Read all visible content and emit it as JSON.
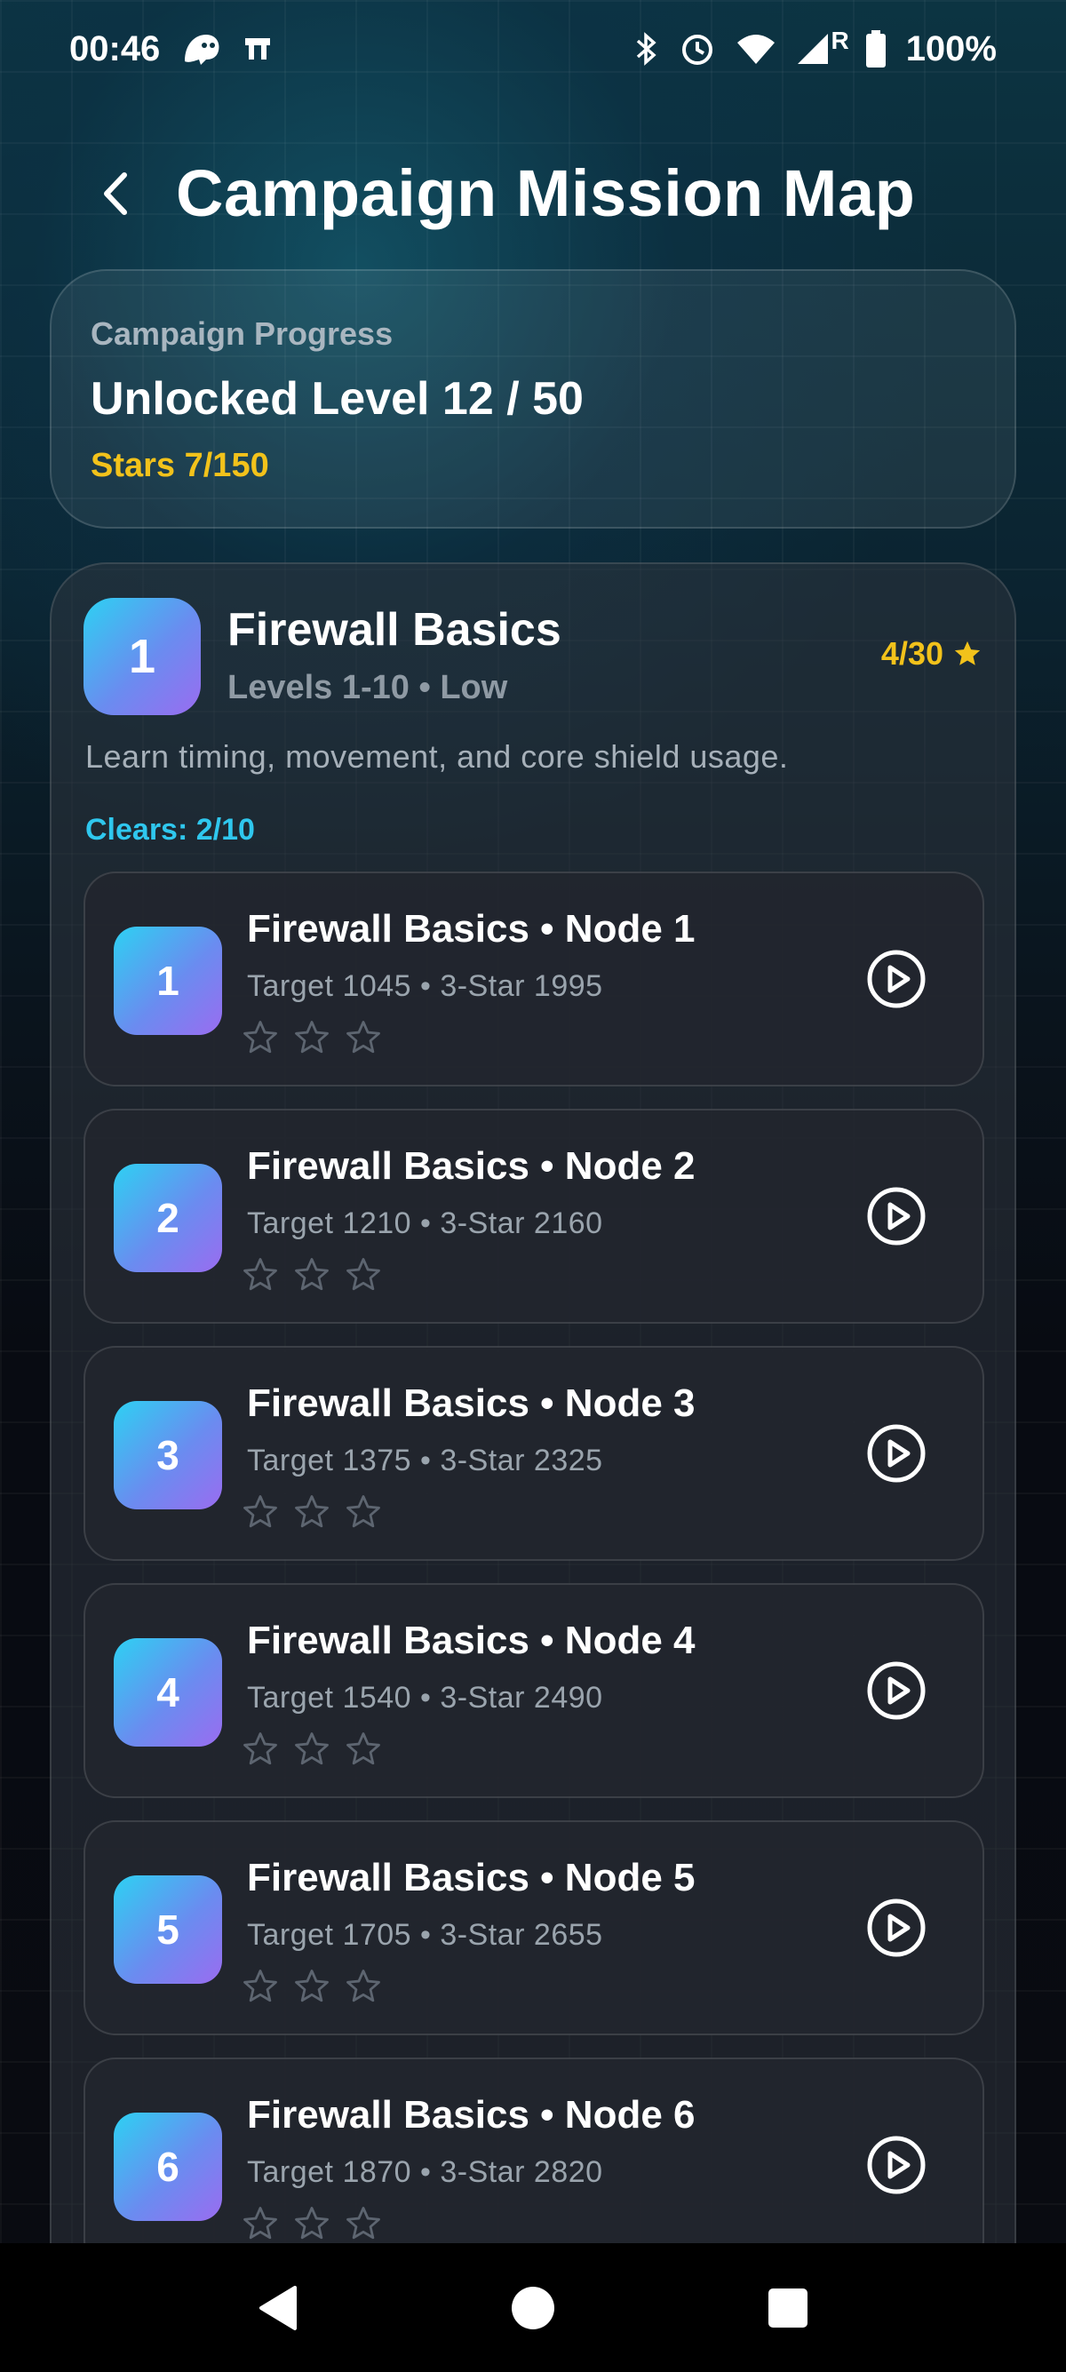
{
  "status_bar": {
    "time": "00:46",
    "battery": "100%",
    "icons": [
      "ghost-icon",
      "notification-icon",
      "bluetooth-icon",
      "alarm-icon",
      "wifi-icon",
      "signal-icon",
      "battery-icon"
    ],
    "roaming": "R"
  },
  "header": {
    "title": "Campaign Mission Map",
    "back_icon": "chevron-left-icon"
  },
  "progress": {
    "label": "Campaign Progress",
    "title": "Unlocked Level 12 / 50",
    "stars": "Stars 7/150"
  },
  "chapter": {
    "number": "1",
    "title": "Firewall Basics",
    "subtitle": "Levels 1-10 • Low",
    "stars": "4/30",
    "description": "Learn timing, movement, and core shield usage.",
    "clears": "Clears: 2/10"
  },
  "nodes": [
    {
      "number": "1",
      "title": "Firewall Basics • Node 1",
      "meta": "Target 1045 • 3-Star 1995",
      "stars_earned": 0
    },
    {
      "number": "2",
      "title": "Firewall Basics • Node 2",
      "meta": "Target 1210 • 3-Star 2160",
      "stars_earned": 0
    },
    {
      "number": "3",
      "title": "Firewall Basics • Node 3",
      "meta": "Target 1375 • 3-Star 2325",
      "stars_earned": 0
    },
    {
      "number": "4",
      "title": "Firewall Basics • Node 4",
      "meta": "Target 1540 • 3-Star 2490",
      "stars_earned": 0
    },
    {
      "number": "5",
      "title": "Firewall Basics • Node 5",
      "meta": "Target 1705 • 3-Star 2655",
      "stars_earned": 0
    },
    {
      "number": "6",
      "title": "Firewall Basics • Node 6",
      "meta": "Target 1870 • 3-Star 2820",
      "stars_earned": 0
    }
  ],
  "colors": {
    "accent_gold": "#f2c21b",
    "accent_cyan": "#2fc7ee",
    "badge_start": "#2dd1f2",
    "badge_end": "#9a6cf0"
  },
  "nav": {
    "icons": [
      "back-triangle-icon",
      "home-circle-icon",
      "recents-square-icon"
    ]
  }
}
